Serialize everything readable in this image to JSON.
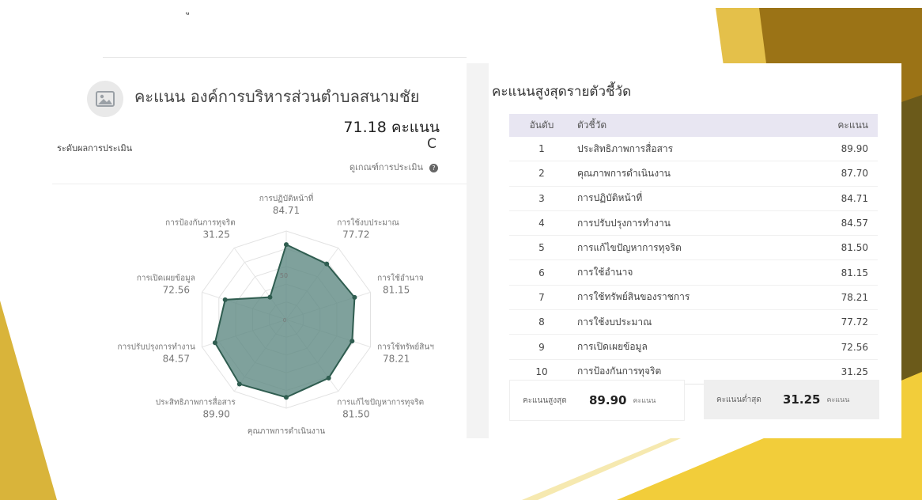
{
  "colors": {
    "accent_gold": "#d9b43a",
    "radar_fill": "#5f8a83",
    "radar_stroke": "#2f5d50",
    "table_header_bg": "#e8e6f2"
  },
  "top_glyph": "ู",
  "left_panel": {
    "image_icon": "image-placeholder-icon",
    "org_title": "คะแนน องค์การบริหารส่วนตำบลสนามชัย",
    "total_score": "71.18 คะแนน",
    "level_label": "ระดับผลการประเมิน",
    "level_value": "C",
    "criteria_link": "ดูเกณฑ์การประเมิน",
    "help_icon": "question-circle-icon"
  },
  "chart_data": {
    "type": "radar",
    "categories": [
      "การปฏิบัติหน้าที่",
      "การใช้งบประมาณ",
      "การใช้อำนาจ",
      "การใช้ทรัพย์สินฯ",
      "การแก้ไขปัญหาการทุจริต",
      "คุณภาพการดำเนินงาน",
      "ประสิทธิภาพการสื่อสาร",
      "การปรับปรุงการทำงาน",
      "การเปิดเผยข้อมูล",
      "การป้องกันการทุจริต"
    ],
    "values": [
      84.71,
      77.72,
      81.15,
      78.21,
      81.5,
      87.7,
      89.9,
      84.57,
      72.56,
      31.25
    ],
    "value_labels": [
      "84.71",
      "77.72",
      "81.15",
      "78.21",
      "81.50",
      "87.70",
      "89.90",
      "84.57",
      "72.56",
      "31.25"
    ],
    "ring_labels": [
      "0",
      "50"
    ],
    "rlim": [
      0,
      100
    ]
  },
  "right_panel": {
    "title": "คะแนนสูงสุดรายตัวชี้วัด",
    "columns": [
      "อันดับ",
      "ตัวชี้วัด",
      "คะแนน"
    ],
    "rows": [
      {
        "rank": "1",
        "name": "ประสิทธิภาพการสื่อสาร",
        "score": "89.90"
      },
      {
        "rank": "2",
        "name": "คุณภาพการดำเนินงาน",
        "score": "87.70"
      },
      {
        "rank": "3",
        "name": "การปฏิบัติหน้าที่",
        "score": "84.71"
      },
      {
        "rank": "4",
        "name": "การปรับปรุงการทำงาน",
        "score": "84.57"
      },
      {
        "rank": "5",
        "name": "การแก้ไขปัญหาการทุจริต",
        "score": "81.50"
      },
      {
        "rank": "6",
        "name": "การใช้อำนาจ",
        "score": "81.15"
      },
      {
        "rank": "7",
        "name": "การใช้ทรัพย์สินของราชการ",
        "score": "78.21"
      },
      {
        "rank": "8",
        "name": "การใช้งบประมาณ",
        "score": "77.72"
      },
      {
        "rank": "9",
        "name": "การเปิดเผยข้อมูล",
        "score": "72.56"
      },
      {
        "rank": "10",
        "name": "การป้องกันการทุจริต",
        "score": "31.25"
      }
    ],
    "highest": {
      "label": "คะแนนสูงสุด",
      "value": "89.90",
      "unit": "คะแนน"
    },
    "lowest": {
      "label": "คะแนนต่ำสุด",
      "value": "31.25",
      "unit": "คะแนน"
    }
  }
}
